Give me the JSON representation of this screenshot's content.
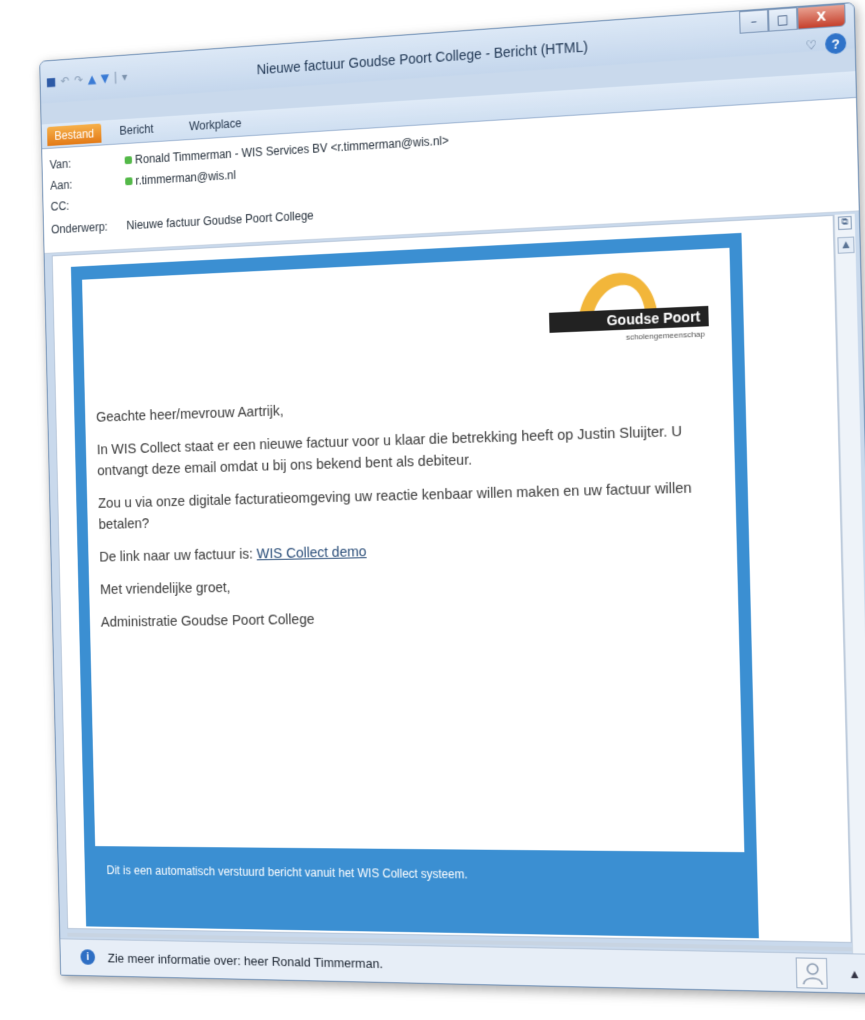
{
  "window": {
    "title": "Nieuwe factuur Goudse Poort College - Bericht (HTML)",
    "controls": {
      "minimize": "–",
      "maximize": "□",
      "close": "X"
    },
    "help": "?",
    "ribbon_caret": "♡"
  },
  "qat": {
    "save": "■",
    "undo": "↶",
    "redo": "↷",
    "up": "▲",
    "down": "▼",
    "sep": "|",
    "more": "▾"
  },
  "tabs": [
    {
      "label": "Bestand"
    },
    {
      "label": "Bericht"
    },
    {
      "label": "Workplace"
    }
  ],
  "headers": {
    "from_label": "Van:",
    "from_value": "Ronald Timmerman - WIS Services BV <r.timmerman@wis.nl>",
    "to_label": "Aan:",
    "to_value": "r.timmerman@wis.nl",
    "cc_label": "CC:",
    "subject_label": "Onderwerp:",
    "subject_value": "Nieuwe factuur Goudse Poort College"
  },
  "mail": {
    "logo_name": "Goudse Poort",
    "logo_sub": "scholengemeenschap",
    "greeting": "Geachte heer/mevrouw Aartrijk,",
    "para1": "In WIS Collect staat er een nieuwe factuur voor u klaar die betrekking heeft op Justin Sluijter. U ontvangt deze email omdat u bij ons bekend bent als debiteur.",
    "para2": "Zou u via onze digitale facturatieomgeving uw reactie kenbaar willen maken en uw factuur willen betalen?",
    "link_prefix": "De link naar uw factuur is: ",
    "link_text": "WIS Collect demo",
    "closing": "Met vriendelijke groet,",
    "signature": "Administratie Goudse Poort College",
    "footer": "Dit is een automatisch verstuurd bericht vanuit het WIS Collect systeem."
  },
  "infobar": {
    "icon": "i",
    "text": "Zie meer informatie over: heer Ronald Timmerman.",
    "expand": "▲"
  },
  "scrollbar": {
    "up": "▲",
    "down": "▼"
  },
  "colors": {
    "mail_frame": "#3b8fd2",
    "logo_gold": "#f2b63a",
    "file_tab": "#e37a17"
  }
}
